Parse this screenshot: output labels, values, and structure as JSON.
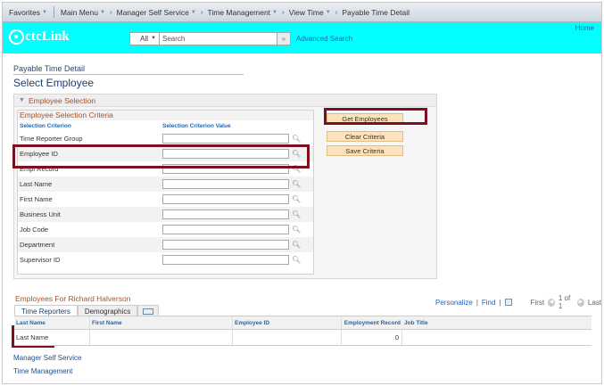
{
  "nav": {
    "favorites": "Favorites",
    "main_menu": "Main Menu",
    "breadcrumbs": [
      "Manager Self Service",
      "Time Management",
      "View Time",
      "Payable Time Detail"
    ]
  },
  "header": {
    "logo_ctc": "ctc",
    "logo_link": "Link",
    "home": "Home",
    "search_scope": "All",
    "search_placeholder": "Search",
    "advanced_search": "Advanced Search"
  },
  "page": {
    "breadcrumb_title": "Payable Time Detail",
    "title": "Select Employee"
  },
  "selection": {
    "group_title": "Employee Selection",
    "criteria_title": "Employee Selection Criteria",
    "col_criterion": "Selection Criterion",
    "col_value": "Selection Criterion Value",
    "rows": [
      {
        "label": "Time Reporter Group",
        "value": ""
      },
      {
        "label": "Employee ID",
        "value": ""
      },
      {
        "label": "Empl Record",
        "value": ""
      },
      {
        "label": "Last Name",
        "value": ""
      },
      {
        "label": "First Name",
        "value": ""
      },
      {
        "label": "Business Unit",
        "value": ""
      },
      {
        "label": "Job Code",
        "value": ""
      },
      {
        "label": "Department",
        "value": ""
      },
      {
        "label": "Supervisor ID",
        "value": ""
      }
    ],
    "buttons": {
      "get_employees": "Get Employees",
      "clear_criteria": "Clear Criteria",
      "save_criteria": "Save Criteria"
    }
  },
  "employees": {
    "title": "Employees For Richard Halverson",
    "personalize": "Personalize",
    "find": "Find",
    "pager_first": "First",
    "pager_range": "1 of 1",
    "pager_last": "Last",
    "tabs": [
      "Time Reporters",
      "Demographics"
    ],
    "columns": [
      "Last Name",
      "First Name",
      "Employee ID",
      "Employment Record",
      "Job Title"
    ],
    "rows": [
      {
        "last_name": "Last Name",
        "first_name": "",
        "employee_id": "",
        "employment_record": "0",
        "job_title": ""
      }
    ]
  },
  "footer": {
    "links": [
      "Manager Self Service",
      "Time Management"
    ]
  },
  "colors": {
    "header_bg": "#01ffff",
    "highlight": "#7a1020",
    "button_bg": "#fde3bb",
    "section_title": "#a5522a"
  }
}
